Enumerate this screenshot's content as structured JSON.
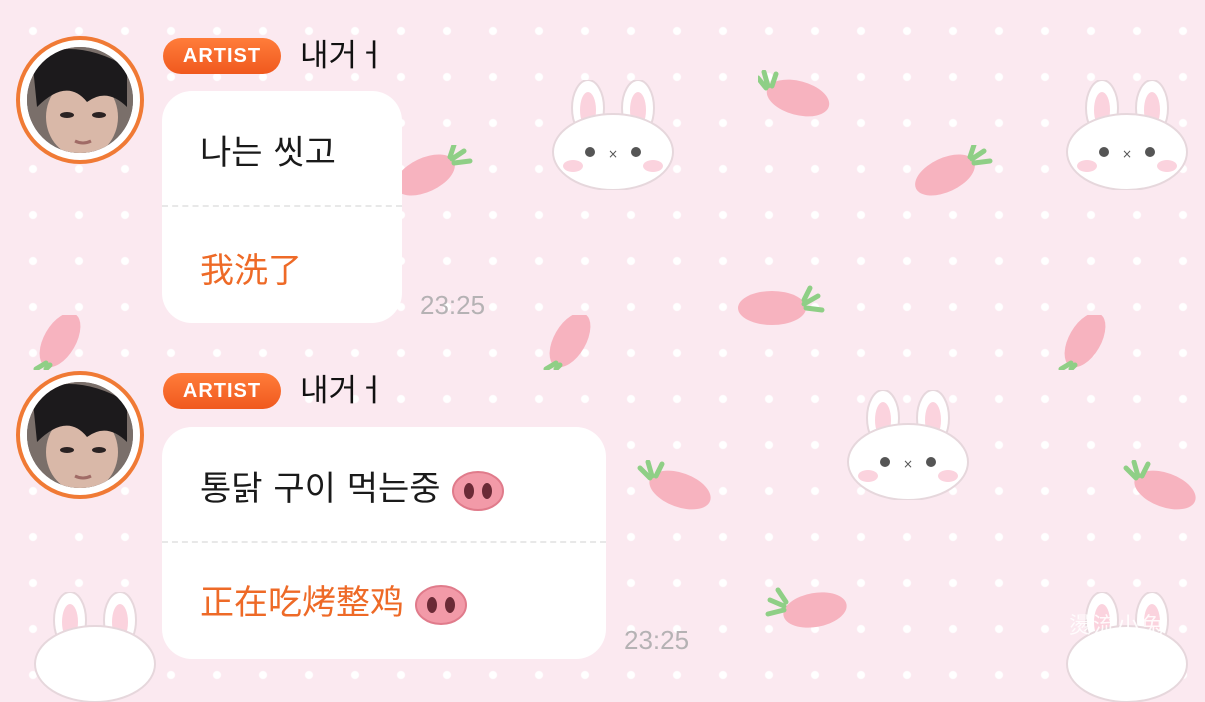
{
  "messages": [
    {
      "badge": "ARTIST",
      "sender": "내거ㅓ",
      "korean": "나는 씻고",
      "chinese": "我洗了",
      "time": "23:25",
      "emoji": ""
    },
    {
      "badge": "ARTIST",
      "sender": "내거ㅓ",
      "korean": "통닭 구이 먹는중",
      "chinese": "正在吃烤整鸡",
      "time": "23:25",
      "emoji": "pig-nose-icon"
    }
  ],
  "watermark": "燙流小兔",
  "colors": {
    "accent": "#f0591e",
    "translation": "#ee6a27",
    "background": "#fbe9f0",
    "avatar_ring": "#f07a35",
    "timestamp": "#b5b2b4"
  }
}
